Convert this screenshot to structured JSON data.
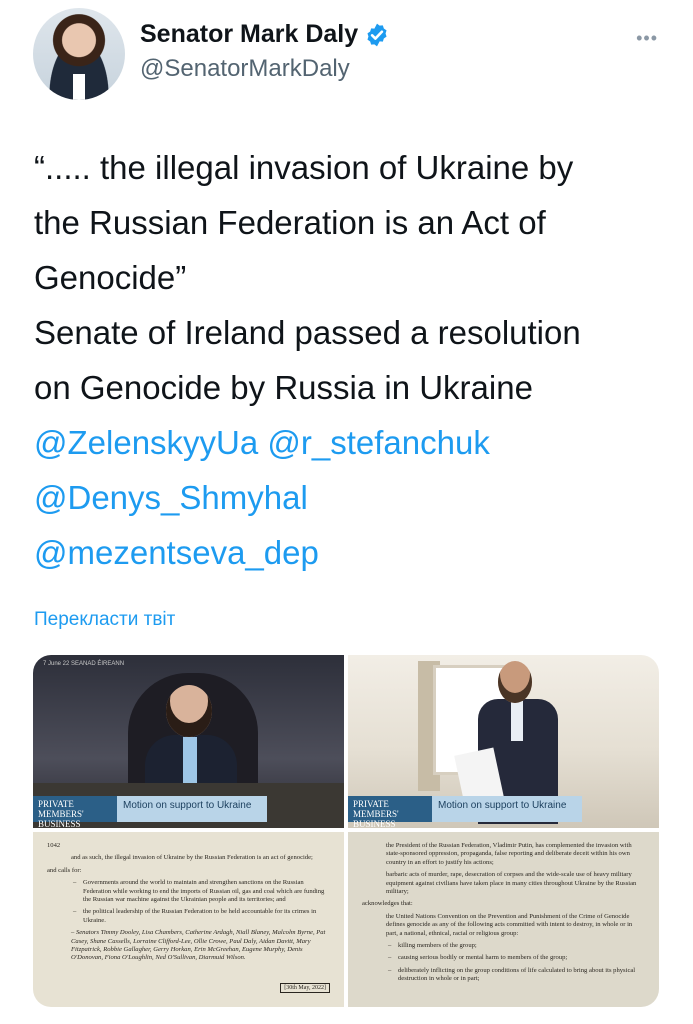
{
  "author": {
    "display_name": "Senator Mark Daly",
    "handle": "@SenatorMarkDaly",
    "verified": true
  },
  "more_menu": "•••",
  "tweet": {
    "lines": [
      {
        "text": "“..... the illegal invasion of Ukraine by",
        "type": "text"
      },
      {
        "text": "the Russian Federation is an Act of",
        "type": "text"
      },
      {
        "text": "Genocide”",
        "type": "text"
      },
      {
        "text": "Senate of Ireland passed a resolution",
        "type": "text"
      },
      {
        "text": "on Genocide by Russia in Ukraine",
        "type": "text"
      },
      {
        "text": "@ZelenskyyUa @r_stefanchuk",
        "type": "mention"
      },
      {
        "text": "@Denys_Shmyhal",
        "type": "mention"
      },
      {
        "text": "@mezentseva_dep",
        "type": "mention"
      }
    ]
  },
  "translate_label": "Перекласти твіт",
  "media": {
    "video_tag": "PRIVATE MEMBERS' BUSINESS",
    "video_title": "Motion on support to Ukraine",
    "channel_small": "7 June 22 SEANAD ÉIREANN",
    "doc_left": {
      "header": "1042",
      "paras": [
        "and as such, the illegal invasion of Ukraine by the Russian Federation is an act of genocide;",
        "and calls for:",
        "Governments around the world to maintain and strengthen sanctions on the Russian Federation while working to end the imports of Russian oil, gas and coal which are funding the Russian war machine against the Ukrainian people and its territories; and",
        "the political leadership of the Russian Federation to be held accountable for its crimes in Ukraine.",
        "– Senators Timmy Dooley, Lisa Chambers, Catherine Ardagh, Niall Blaney, Malcolm Byrne, Pat Casey, Shane Cassells, Lorraine Clifford-Lee, Ollie Crowe, Paul Daly, Aidan Davitt, Mary Fitzpatrick, Robbie Gallagher, Gerry Horkan, Erin McGreehan, Eugene Murphy, Denis O'Donovan, Fiona O'Loughlin, Ned O'Sullivan, Diarmuid Wilson."
      ],
      "date": "[30th May, 2022]"
    },
    "doc_right": {
      "paras": [
        "the President of the Russian Federation, Vladimir Putin, has complemented the invasion with state-sponsored oppression, propaganda, false reporting and deliberate deceit within his own country in an effort to justify his actions;",
        "barbaric acts of murder, rape, desecration of corpses and the wide-scale use of heavy military equipment against civilians have taken place in many cities throughout Ukraine by the Russian military;",
        "acknowledges that:",
        "the United Nations Convention on the Prevention and Punishment of the Crime of Genocide defines genocide as any of the following acts committed with intent to destroy, in whole or in part, a national, ethnical, racial or religious group:",
        "killing members of the group;",
        "causing serious bodily or mental harm to members of the group;",
        "deliberately inflicting on the group conditions of life calculated to bring about its physical destruction in whole or in part;"
      ]
    }
  },
  "colors": {
    "link": "#1d9bf0",
    "verified_badge": "#1d9bf0",
    "handle": "#536471"
  }
}
